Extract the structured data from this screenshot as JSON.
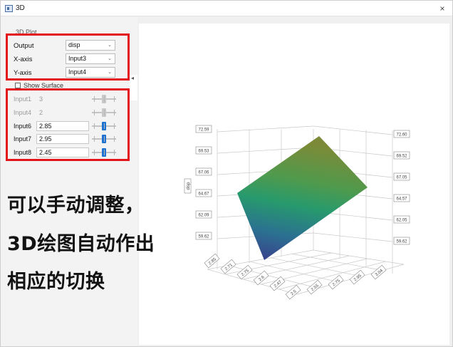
{
  "window": {
    "title": "3D",
    "close_glyph": "×"
  },
  "panel": {
    "group_title": "3D Plot",
    "output_label": "Output",
    "output_value": "disp",
    "xaxis_label": "X-axis",
    "xaxis_value": "Input3",
    "yaxis_label": "Y-axis",
    "yaxis_value": "Input4",
    "show_surface_label": "Show Surface",
    "inputs": [
      {
        "label": "Input1",
        "value": "3",
        "enabled": false
      },
      {
        "label": "Input4",
        "value": "2",
        "enabled": false
      },
      {
        "label": "Input6",
        "value": "2.85",
        "enabled": true
      },
      {
        "label": "Input7",
        "value": "2.95",
        "enabled": true
      },
      {
        "label": "Input8",
        "value": "2.45",
        "enabled": true
      }
    ]
  },
  "annotation": {
    "line1": "可以手动调整，",
    "line2": "3D绘图自动作出",
    "line3": "相应的切换"
  },
  "plot": {
    "z_axis_label": "disp",
    "z_ticks_left": [
      "72.59",
      "69.53",
      "67.06",
      "64.67",
      "62.09",
      "59.62"
    ],
    "z_ticks_right": [
      "72.60",
      "69.52",
      "67.05",
      "64.57",
      "62.05",
      "59.62"
    ],
    "bottom_left_ticks": [
      "2.85",
      "2.71",
      "2.75",
      "2.6",
      "2.47"
    ],
    "bottom_right_ticks": [
      "2.5",
      "2.55",
      "2.75",
      "2.95",
      "3.04"
    ],
    "colors": {
      "surface_top": "#7c8a37",
      "surface_mid": "#279a6d",
      "surface_low": "#2b7091",
      "surface_bottom": "#3b3b8c",
      "accent": "#1e73d2",
      "highlight": "#e3141a"
    }
  }
}
